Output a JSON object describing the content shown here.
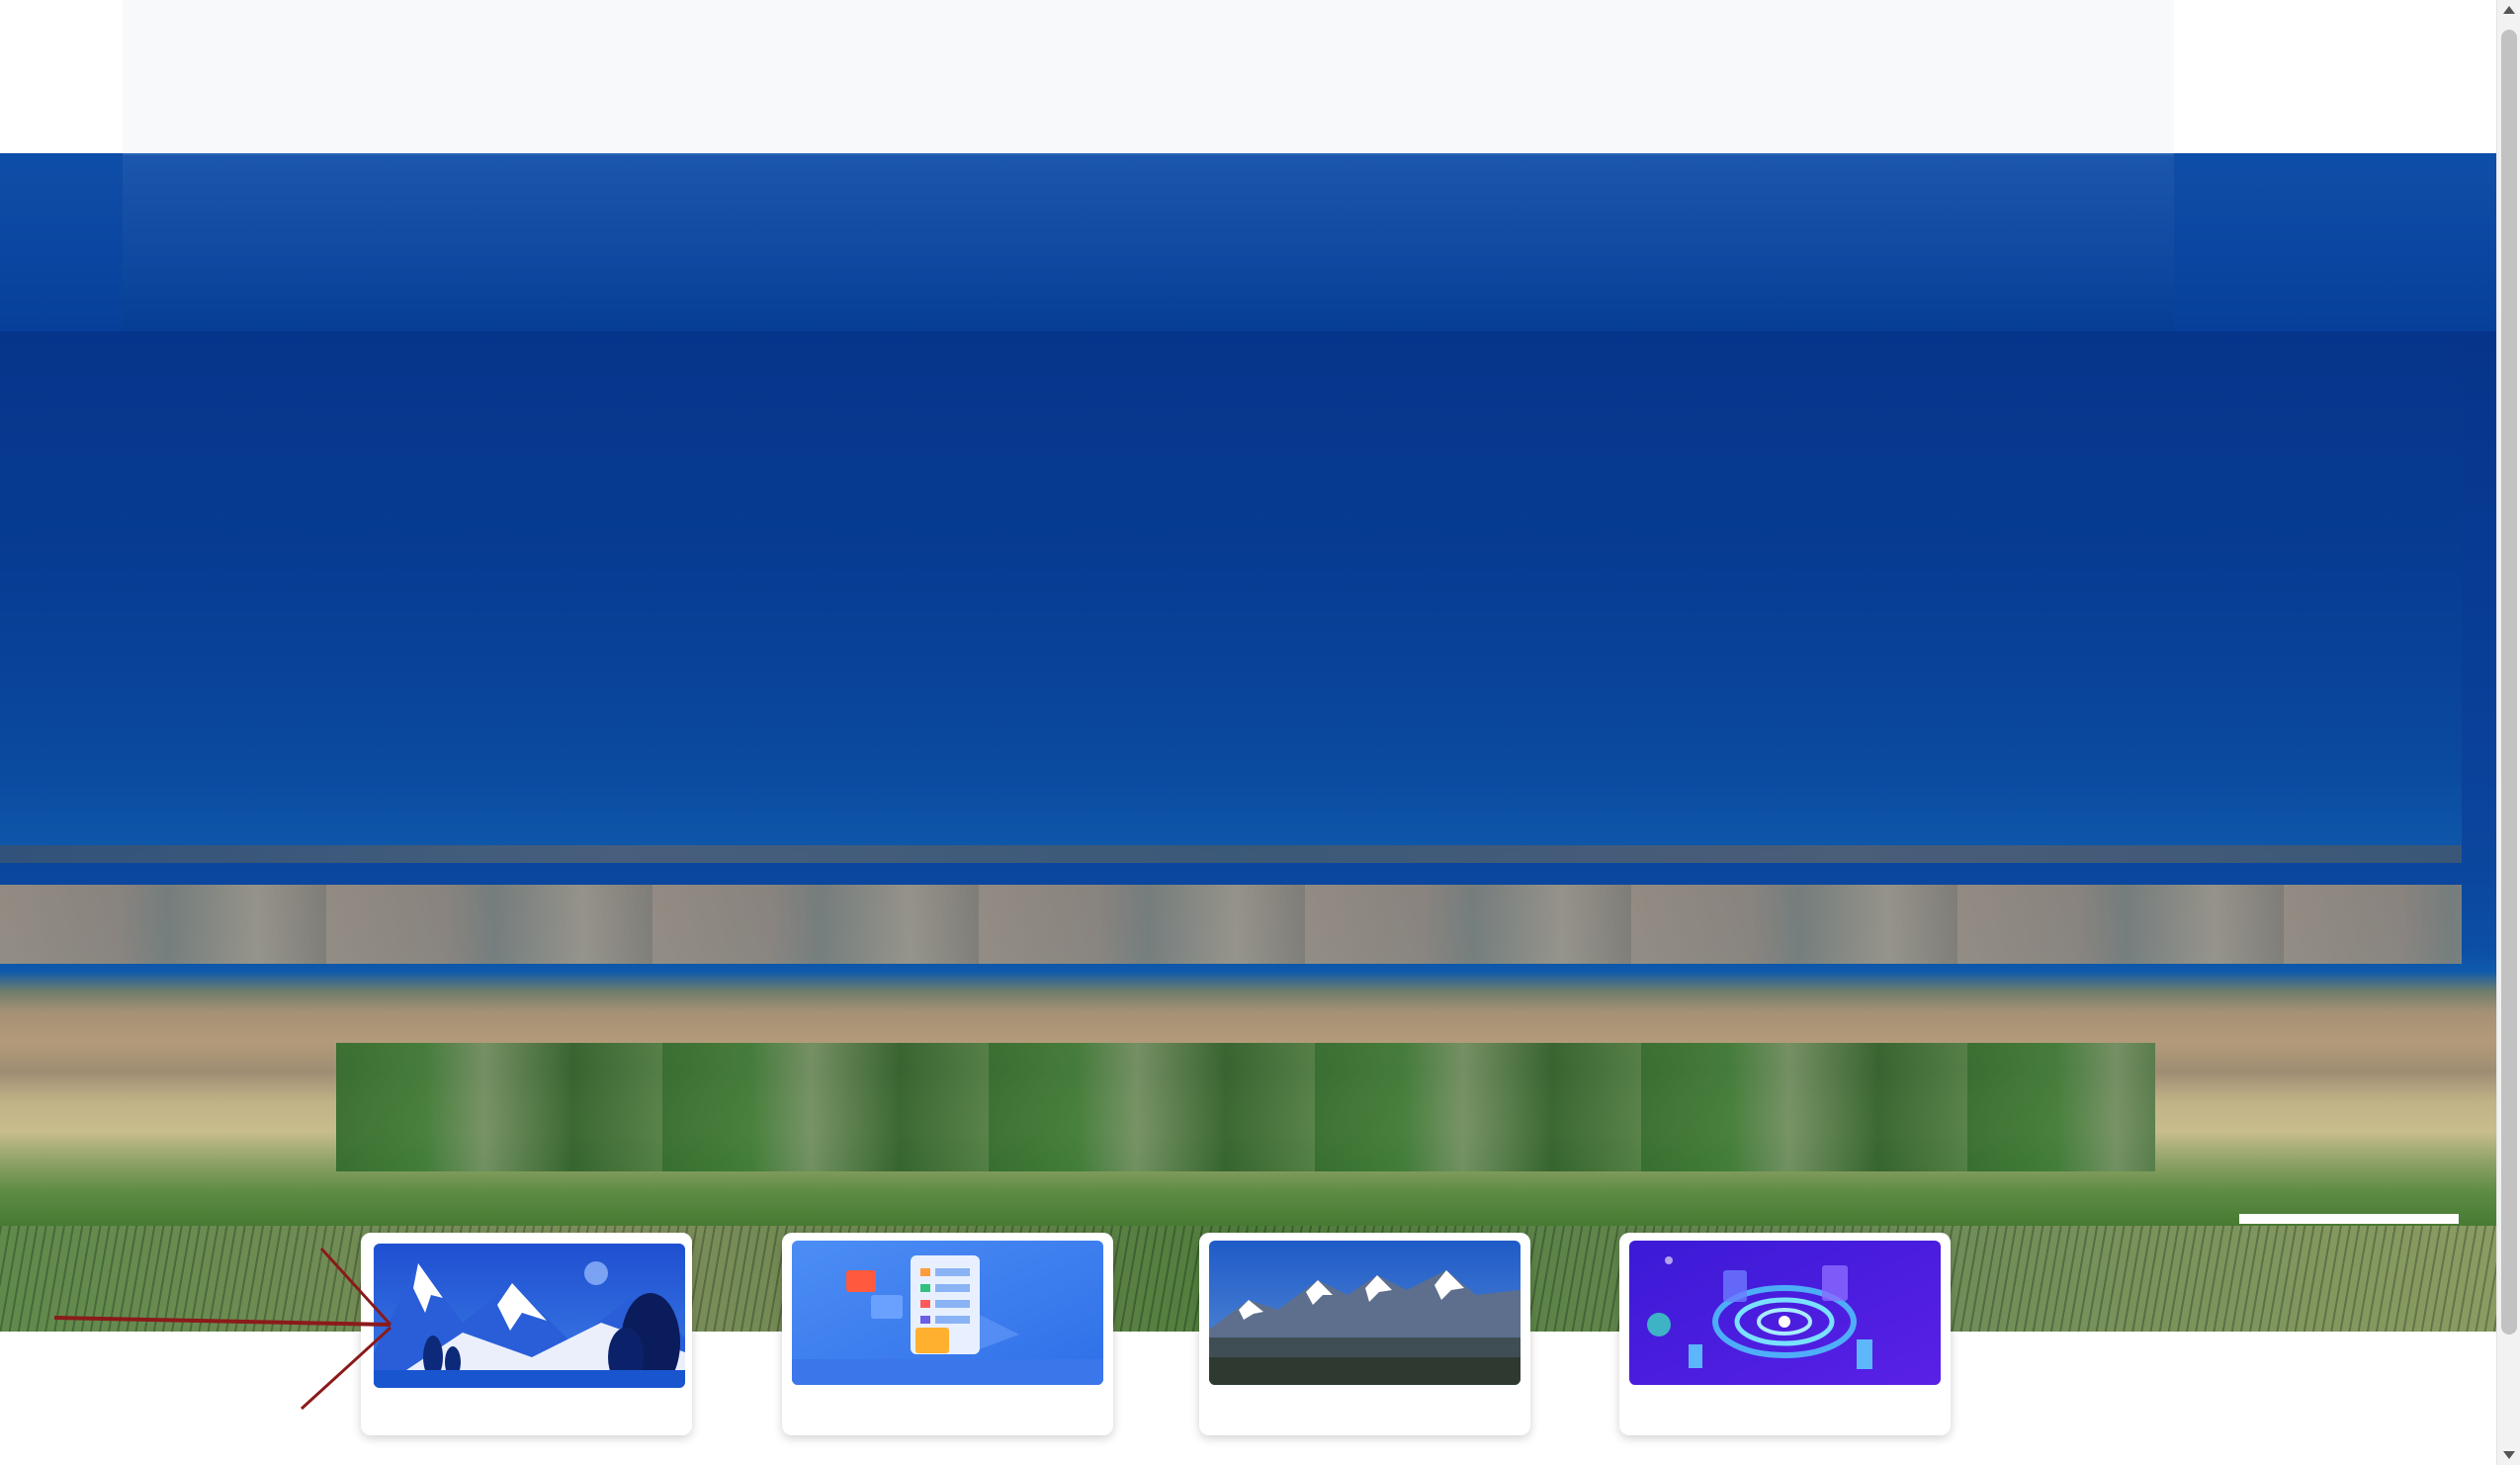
{
  "page": {
    "background": "#ffffff"
  },
  "nav": {
    "color": "#0a46a1"
  },
  "hero": {
    "scene": "aerial-lake-landscape"
  },
  "thumbnails": [
    {
      "icon": "mountain-illustration-icon",
      "caption": "",
      "selected": true
    },
    {
      "icon": "app-isometric-illustration-icon",
      "caption": "",
      "selected": false
    },
    {
      "icon": "snow-mountain-photo-icon",
      "caption": "",
      "selected": false
    },
    {
      "icon": "tech-circle-illustration-icon",
      "caption": "",
      "selected": false
    }
  ],
  "annotation": {
    "color": "#8b1a1a",
    "target": "thumbnail-1"
  }
}
